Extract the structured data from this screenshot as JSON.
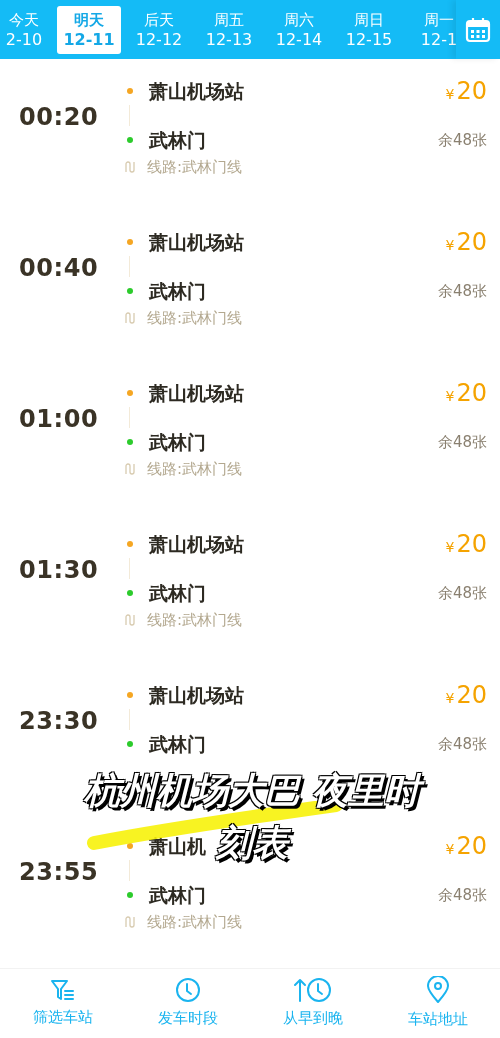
{
  "date_tabs": [
    {
      "day": "今天",
      "date": "2-10",
      "selected": false
    },
    {
      "day": "明天",
      "date": "12-11",
      "selected": true
    },
    {
      "day": "后天",
      "date": "12-12",
      "selected": false
    },
    {
      "day": "周五",
      "date": "12-13",
      "selected": false
    },
    {
      "day": "周六",
      "date": "12-14",
      "selected": false
    },
    {
      "day": "周日",
      "date": "12-15",
      "selected": false
    },
    {
      "day": "周一",
      "date": "12-1",
      "selected": false
    }
  ],
  "trips": [
    {
      "time": "00:20",
      "from": "萧山机场站",
      "to": "武林门",
      "price": "20",
      "currency": "¥",
      "remaining": "余48张",
      "route": "线路:武林门线"
    },
    {
      "time": "00:40",
      "from": "萧山机场站",
      "to": "武林门",
      "price": "20",
      "currency": "¥",
      "remaining": "余48张",
      "route": "线路:武林门线"
    },
    {
      "time": "01:00",
      "from": "萧山机场站",
      "to": "武林门",
      "price": "20",
      "currency": "¥",
      "remaining": "余48张",
      "route": "线路:武林门线"
    },
    {
      "time": "01:30",
      "from": "萧山机场站",
      "to": "武林门",
      "price": "20",
      "currency": "¥",
      "remaining": "余48张",
      "route": "线路:武林门线"
    },
    {
      "time": "23:30",
      "from": "萧山机场站",
      "to": "武林门",
      "price": "20",
      "currency": "¥",
      "remaining": "余48张"
    },
    {
      "time": "23:55",
      "from": "萧山机",
      "to": "武林门",
      "price": "20",
      "currency": "¥",
      "remaining": "余48张",
      "route": "线路:武林门线"
    }
  ],
  "caption": [
    "杭州机场大巴 夜里时",
    "刻表"
  ],
  "bottom_bar": [
    {
      "kind": "filter",
      "label": "筛选车站"
    },
    {
      "kind": "clock",
      "label": "发车时段"
    },
    {
      "kind": "sort",
      "label": "从早到晚"
    },
    {
      "kind": "pin",
      "label": "车站地址"
    }
  ]
}
